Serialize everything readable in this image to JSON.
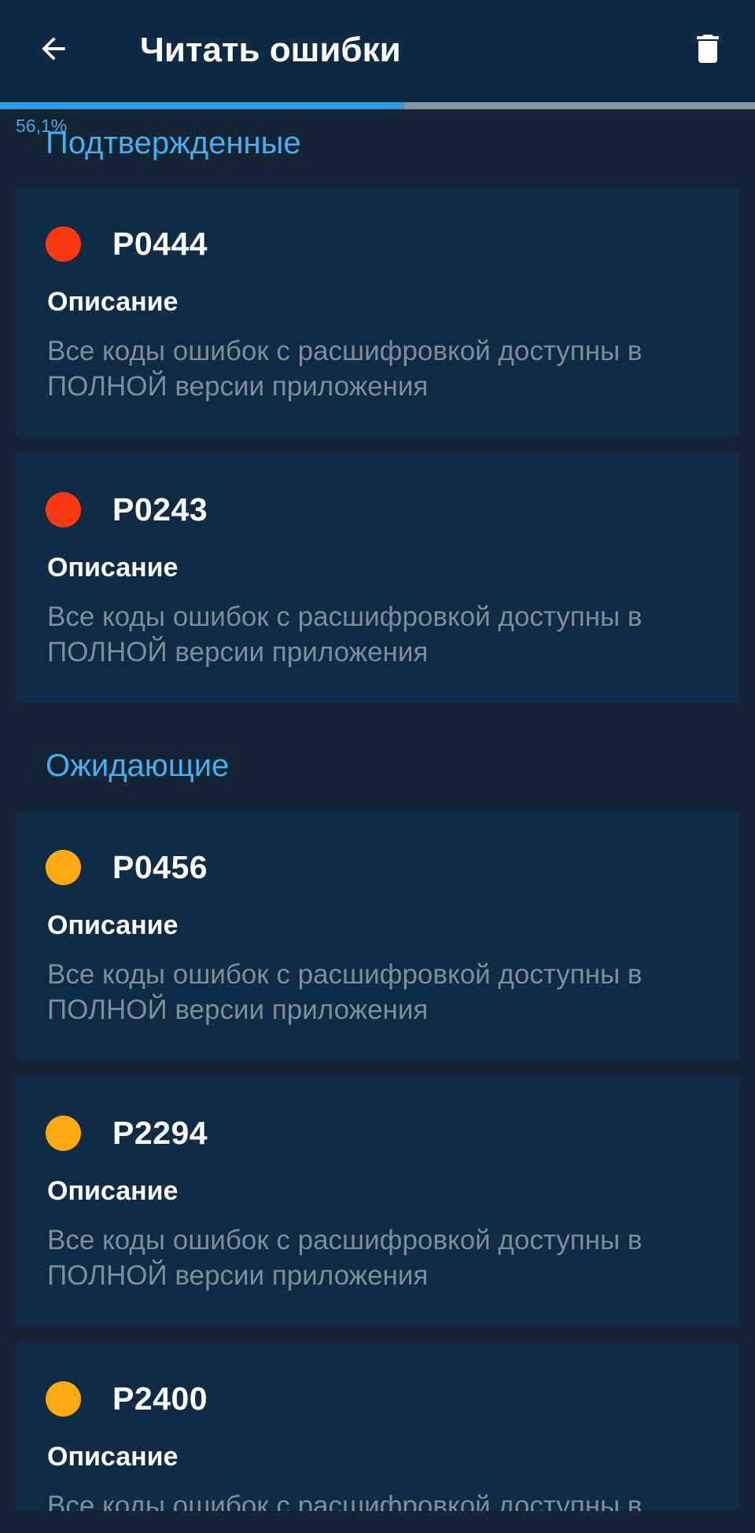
{
  "appbar": {
    "title": "Читать ошибки",
    "back_icon": "arrow-left-icon",
    "delete_icon": "trash-icon"
  },
  "progress": {
    "label": "56,1%",
    "value": 0.561
  },
  "sections": {
    "confirmed": {
      "title": "Подтвержденные",
      "items": [
        {
          "code": "P0444",
          "label": "Описание",
          "text": "Все коды ошибок с расшифровкой доступны в ПОЛНОЙ версии приложения"
        },
        {
          "code": "P0243",
          "label": "Описание",
          "text": "Все коды ошибок с расшифровкой доступны в ПОЛНОЙ версии приложения"
        }
      ]
    },
    "pending": {
      "title": "Ожидающие",
      "items": [
        {
          "code": "P0456",
          "label": "Описание",
          "text": "Все коды ошибок с расшифровкой доступны в ПОЛНОЙ версии приложения"
        },
        {
          "code": "P2294",
          "label": "Описание",
          "text": "Все коды ошибок с расшифровкой доступны в ПОЛНОЙ версии приложения"
        },
        {
          "code": "P2400",
          "label": "Описание",
          "text": "Все коды ошибок с расшифровкой доступны в ПОЛНОЙ версии приложения"
        }
      ]
    }
  },
  "colors": {
    "confirmed_dot": "#fc3a12",
    "pending_dot": "#fea90f",
    "accent": "#47aef0"
  }
}
